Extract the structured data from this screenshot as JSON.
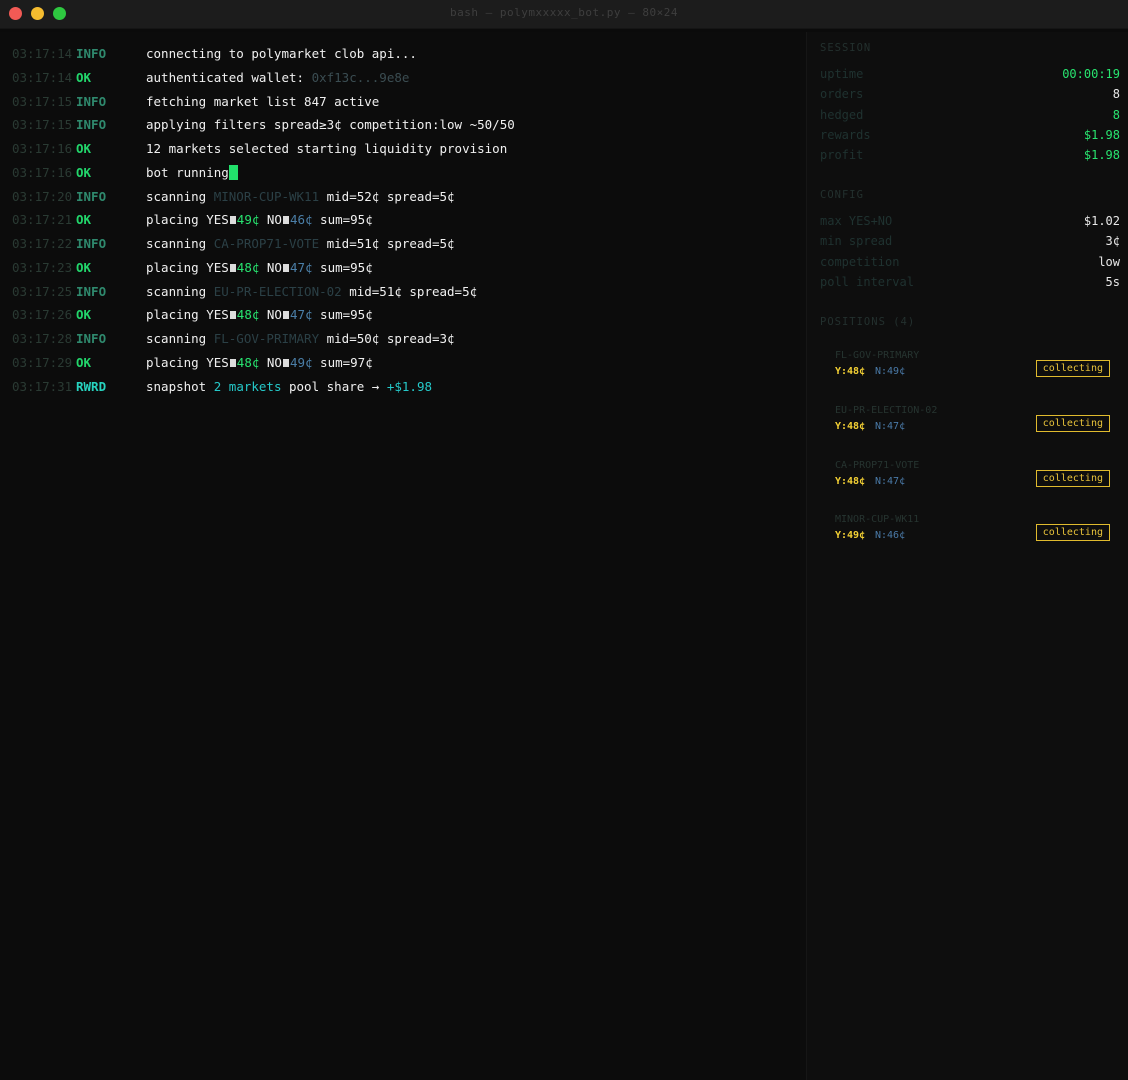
{
  "window": {
    "title": "bash — polymxxxxx_bot.py — 80×24"
  },
  "log": [
    {
      "ts": "03:17:14",
      "level": "INFO",
      "cls": "info",
      "parts": [
        {
          "t": "connecting to polymarket clob api..."
        }
      ]
    },
    {
      "ts": "03:17:14",
      "level": "OK",
      "cls": "ok",
      "parts": [
        {
          "t": "authenticated wallet: "
        },
        {
          "t": "0xf13c...9e8e",
          "s": "dimw"
        }
      ]
    },
    {
      "ts": "03:17:15",
      "level": "INFO",
      "cls": "info",
      "parts": [
        {
          "t": "fetching market list 847 active"
        }
      ]
    },
    {
      "ts": "03:17:15",
      "level": "INFO",
      "cls": "info",
      "parts": [
        {
          "t": "applying filters spread≥3¢ competition:low ~50/50"
        }
      ]
    },
    {
      "ts": "03:17:16",
      "level": "OK",
      "cls": "ok",
      "parts": [
        {
          "t": "12 markets selected starting liquidity provision"
        }
      ]
    },
    {
      "ts": "03:17:16",
      "level": "OK",
      "cls": "ok",
      "parts": [
        {
          "t": "bot running"
        },
        {
          "cursor": true
        }
      ]
    },
    {
      "ts": "03:17:20",
      "level": "INFO",
      "cls": "info",
      "parts": [
        {
          "t": "scanning "
        },
        {
          "t": "MINOR-CUP-WK11",
          "s": "dim"
        },
        {
          "t": " mid=52¢ spread=5¢"
        }
      ]
    },
    {
      "ts": "03:17:21",
      "level": "OK",
      "cls": "ok",
      "parts": [
        {
          "t": "placing YES"
        },
        {
          "sq": true
        },
        {
          "t": "49¢",
          "s": "g"
        },
        {
          "t": " NO"
        },
        {
          "sq": true
        },
        {
          "t": "46¢",
          "s": "b"
        },
        {
          "t": " sum=95¢"
        }
      ]
    },
    {
      "ts": "03:17:22",
      "level": "INFO",
      "cls": "info",
      "parts": [
        {
          "t": "scanning "
        },
        {
          "t": "CA-PROP71-VOTE",
          "s": "dim"
        },
        {
          "t": " mid=51¢ spread=5¢"
        }
      ]
    },
    {
      "ts": "03:17:23",
      "level": "OK",
      "cls": "ok",
      "parts": [
        {
          "t": "placing YES"
        },
        {
          "sq": true
        },
        {
          "t": "48¢",
          "s": "g"
        },
        {
          "t": " NO"
        },
        {
          "sq": true
        },
        {
          "t": "47¢",
          "s": "b"
        },
        {
          "t": " sum=95¢"
        }
      ]
    },
    {
      "ts": "03:17:25",
      "level": "INFO",
      "cls": "info",
      "parts": [
        {
          "t": "scanning "
        },
        {
          "t": "EU-PR-ELECTION-02",
          "s": "dim"
        },
        {
          "t": " mid=51¢ spread=5¢"
        }
      ]
    },
    {
      "ts": "03:17:26",
      "level": "OK",
      "cls": "ok",
      "parts": [
        {
          "t": "placing YES"
        },
        {
          "sq": true
        },
        {
          "t": "48¢",
          "s": "g"
        },
        {
          "t": " NO"
        },
        {
          "sq": true
        },
        {
          "t": "47¢",
          "s": "b"
        },
        {
          "t": " sum=95¢"
        }
      ]
    },
    {
      "ts": "03:17:28",
      "level": "INFO",
      "cls": "info",
      "parts": [
        {
          "t": "scanning "
        },
        {
          "t": "FL-GOV-PRIMARY",
          "s": "dim"
        },
        {
          "t": " mid=50¢ spread=3¢"
        }
      ]
    },
    {
      "ts": "03:17:29",
      "level": "OK",
      "cls": "ok",
      "parts": [
        {
          "t": "placing YES"
        },
        {
          "sq": true
        },
        {
          "t": "48¢",
          "s": "g"
        },
        {
          "t": " NO"
        },
        {
          "sq": true
        },
        {
          "t": "49¢",
          "s": "b"
        },
        {
          "t": " sum=97¢"
        }
      ]
    },
    {
      "ts": "03:17:31",
      "level": "RWRD",
      "cls": "rwrd",
      "parts": [
        {
          "t": "snapshot "
        },
        {
          "t": "2",
          "s": "c"
        },
        {
          "t": " "
        },
        {
          "t": "markets",
          "s": "c"
        },
        {
          "t": " pool share → "
        },
        {
          "t": "+$1.98",
          "s": "c"
        }
      ]
    }
  ],
  "session": {
    "heading": "SESSION",
    "rows": [
      {
        "key": "uptime",
        "value": "00:00:19",
        "green": true
      },
      {
        "key": "orders",
        "value": "8",
        "green": false
      },
      {
        "key": "hedged",
        "value": "8",
        "green": true
      },
      {
        "key": "rewards",
        "value": "$1.98",
        "green": true
      },
      {
        "key": "profit",
        "value": "$1.98",
        "green": true
      }
    ]
  },
  "config": {
    "heading": "CONFIG",
    "rows": [
      {
        "key": "max YES+NO",
        "value": "$1.02"
      },
      {
        "key": "min spread",
        "value": "3¢"
      },
      {
        "key": "competition",
        "value": "low"
      },
      {
        "key": "poll interval",
        "value": "5s"
      }
    ]
  },
  "positions": {
    "heading": "POSITIONS (4)",
    "items": [
      {
        "name": "FL-GOV-PRIMARY",
        "yes": "Y:48¢",
        "no": "N:49¢",
        "status": "collecting"
      },
      {
        "name": "EU-PR-ELECTION-02",
        "yes": "Y:48¢",
        "no": "N:47¢",
        "status": "collecting"
      },
      {
        "name": "CA-PROP71-VOTE",
        "yes": "Y:48¢",
        "no": "N:47¢",
        "status": "collecting"
      },
      {
        "name": "MINOR-CUP-WK11",
        "yes": "Y:49¢",
        "no": "N:46¢",
        "status": "collecting"
      }
    ]
  }
}
